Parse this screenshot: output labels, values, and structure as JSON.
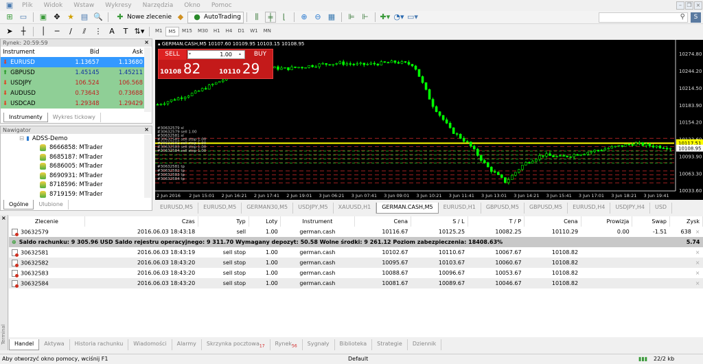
{
  "menu": [
    "Plik",
    "Widok",
    "Wstaw",
    "Wykresy",
    "Narzędzia",
    "Okno",
    "Pomoc"
  ],
  "toolbar": {
    "new_order": "Nowe zlecenie",
    "autotrading": "AutoTrading",
    "timeframes": [
      "M1",
      "M5",
      "M15",
      "M30",
      "H1",
      "H4",
      "D1",
      "W1",
      "MN"
    ],
    "active_tf": "M5",
    "search_placeholder": ""
  },
  "market_watch": {
    "title": "Rynek: 20:59:59",
    "columns": [
      "Instrument",
      "Bid",
      "Ask"
    ],
    "rows": [
      {
        "symbol": "EURUSD",
        "bid": "1.13657",
        "ask": "1.13680",
        "dir": "down",
        "selected": true
      },
      {
        "symbol": "GBPUSD",
        "bid": "1.45145",
        "ask": "1.45211",
        "dir": "up"
      },
      {
        "symbol": "USDJPY",
        "bid": "106.524",
        "ask": "106.568",
        "dir": "down"
      },
      {
        "symbol": "AUDUSD",
        "bid": "0.73643",
        "ask": "0.73688",
        "dir": "down"
      },
      {
        "symbol": "USDCAD",
        "bid": "1.29348",
        "ask": "1.29429",
        "dir": "down"
      }
    ],
    "tabs": [
      "Instrumenty",
      "Wykres tickowy"
    ]
  },
  "navigator": {
    "title": "Nawigator",
    "server": "ADSS-Demo",
    "accounts": [
      "8666858: MTrader",
      "8685187: MTrader",
      "8686005: MTrader",
      "8690931: MTrader",
      "8718596: MTrader",
      "8719159: MTrader"
    ],
    "tabs": [
      "Ogólne",
      "Ulubione"
    ]
  },
  "chart": {
    "header": "GERMAN.CASH,M5  10107.60 10109.95 10103.15 10108.95",
    "one_click": {
      "sell": "SELL",
      "buy": "BUY",
      "lots": "1.00",
      "sell_big": "10108",
      "sell_small": "82",
      "buy_big": "10110",
      "buy_small": "29"
    },
    "price_labels": [
      "10274.80",
      "10244.20",
      "10214.50",
      "10183.90",
      "10154.20",
      "10123.60",
      "10093.90",
      "10063.30",
      "10033.60"
    ],
    "current_price_yellow": "10117.51",
    "current_price_white": "10108.95",
    "time_labels": [
      "2 Jun 2016",
      "2 Jun 15:01",
      "2 Jun 16:21",
      "2 Jun 17:41",
      "2 Jun 19:01",
      "3 Jun 06:21",
      "3 Jun 07:41",
      "3 Jun 09:01",
      "3 Jun 10:21",
      "3 Jun 11:41",
      "3 Jun 13:01",
      "3 Jun 14:21",
      "3 Jun 15:41",
      "3 Jun 17:01",
      "3 Jun 18:21",
      "3 Jun 19:41"
    ],
    "price_path": [
      10185,
      10195,
      10205,
      10220,
      10235,
      10245,
      10250,
      10248,
      10252,
      10256,
      10258,
      10255,
      10257,
      10260,
      10255,
      10185,
      10140,
      10115,
      10075,
      10048,
      10080,
      10096,
      10092,
      10098,
      10104,
      10110,
      10116,
      10112,
      10109
    ],
    "order_labels": [
      "#30632579 sl",
      "#30632579 sell 1.00",
      "#30632581 sl",
      "#30632581 sell stop 1.00",
      "#30632582 sell stop 1.00",
      "#30632583 sell stop 1.00",
      "#30632584 sell stop 1.00",
      "#30632581 tp",
      "#30632582 tp",
      "#30632583 tp",
      "#30632584 tp"
    ],
    "levels": {
      "open": 10116.67,
      "sl": [
        10125.25,
        10110.67,
        10103.67,
        10096.67,
        10089.67
      ],
      "entries": [
        10102.67,
        10095.67,
        10088.67,
        10081.67
      ],
      "tp": [
        10082.25,
        10067.67,
        10060.67,
        10053.67,
        10046.67
      ]
    },
    "colors": {
      "candle": "#00ff00",
      "open_line": "#ffff00",
      "sl_tp": "#a02020",
      "entry": "#20a020"
    },
    "tabs": [
      "EURUSD,M5",
      "EURUSD,M5",
      "GERMAN30,M5",
      "USDJPY,M5",
      "XAUUSD,H1",
      "GERMAN.CASH,M5",
      "EURUSD,H1",
      "GBPUSD,M5",
      "GBPUSD,M5",
      "EURUSD,H4",
      "USDJPY,H4",
      "USD"
    ],
    "active_tab": 5
  },
  "terminal": {
    "side_label": "Terminal",
    "columns": [
      "Zlecenie",
      "Czas",
      "Typ",
      "Loty",
      "Instrument",
      "Cena",
      "S / L",
      "T / P",
      "Cena",
      "Prowizja",
      "Swap",
      "Zysk"
    ],
    "orders": [
      [
        "30632579",
        "2016.06.03 18:43:18",
        "sell",
        "1.00",
        "german.cash",
        "10116.67",
        "10125.25",
        "10082.25",
        "10110.29",
        "0.00",
        "-1.51",
        "638"
      ]
    ],
    "balance_line": "Saldo rachunku: 9 305.96 USD  Saldo rejestru operacyjnego: 9 311.70  Wymagany depozyt: 50.58  Wolne środki: 9 261.12  Poziom zabezpieczenia: 18408.63%",
    "balance_profit": "5.74",
    "pending": [
      [
        "30632581",
        "2016.06.03 18:43:19",
        "sell stop",
        "1.00",
        "german.cash",
        "10102.67",
        "10110.67",
        "10067.67",
        "10108.82",
        "",
        "",
        ""
      ],
      [
        "30632582",
        "2016.06.03 18:43:20",
        "sell stop",
        "1.00",
        "german.cash",
        "10095.67",
        "10103.67",
        "10060.67",
        "10108.82",
        "",
        "",
        ""
      ],
      [
        "30632583",
        "2016.06.03 18:43:20",
        "sell stop",
        "1.00",
        "german.cash",
        "10088.67",
        "10096.67",
        "10053.67",
        "10108.82",
        "",
        "",
        ""
      ],
      [
        "30632584",
        "2016.06.03 18:43:20",
        "sell stop",
        "1.00",
        "german.cash",
        "10081.67",
        "10089.67",
        "10046.67",
        "10108.82",
        "",
        "",
        ""
      ]
    ],
    "tabs": [
      {
        "label": "Handel"
      },
      {
        "label": "Aktywa"
      },
      {
        "label": "Historia rachunku"
      },
      {
        "label": "Wiadomości"
      },
      {
        "label": "Alarmy"
      },
      {
        "label": "Skrzynka pocztowa",
        "badge": "17"
      },
      {
        "label": "Rynek",
        "badge": "56"
      },
      {
        "label": "Sygnały"
      },
      {
        "label": "Biblioteka"
      },
      {
        "label": "Strategie"
      },
      {
        "label": "Dziennik"
      }
    ]
  },
  "status": {
    "help": "Aby otworzyć okno pomocy, wciśnij F1",
    "profile": "Default",
    "traffic": "22/2 kb"
  }
}
